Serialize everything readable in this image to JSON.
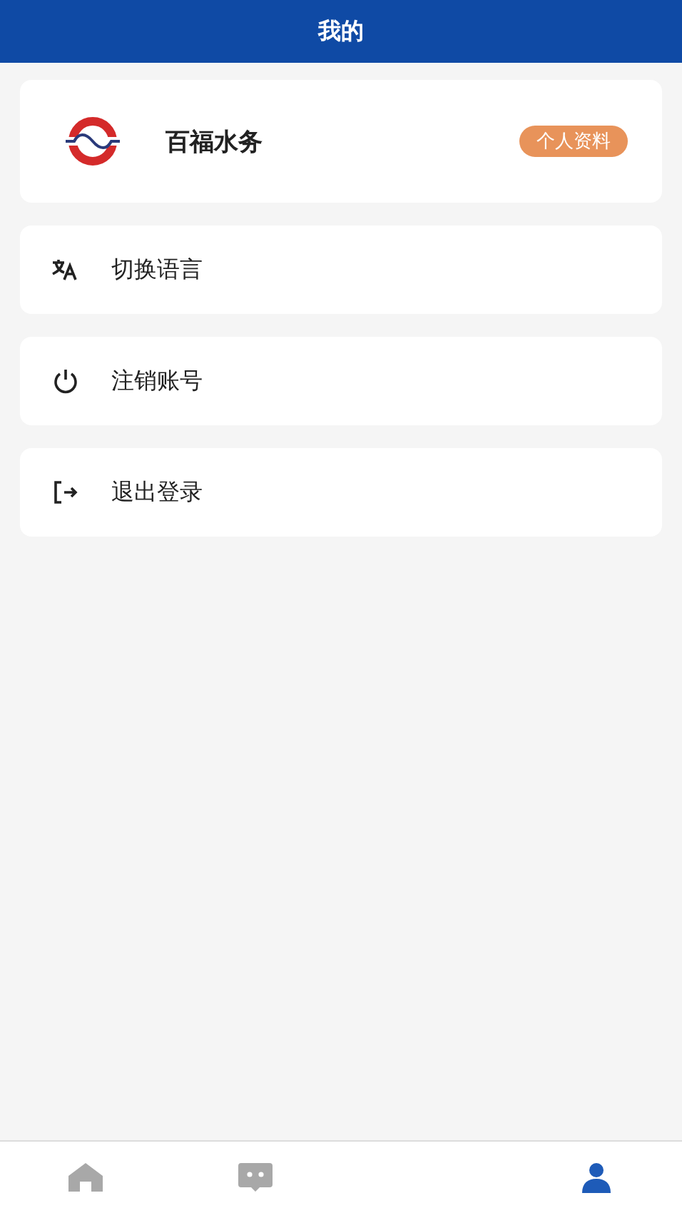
{
  "header": {
    "title": "我的"
  },
  "profile": {
    "name": "百福水务",
    "button": "个人资料"
  },
  "menu": [
    {
      "kind": "language",
      "label": "切换语言"
    },
    {
      "kind": "power",
      "label": "注销账号"
    },
    {
      "kind": "logout",
      "label": "退出登录"
    }
  ],
  "tabs": [
    {
      "kind": "home",
      "selected": false
    },
    {
      "kind": "chat",
      "selected": false
    },
    {
      "kind": "person",
      "selected": true
    }
  ]
}
